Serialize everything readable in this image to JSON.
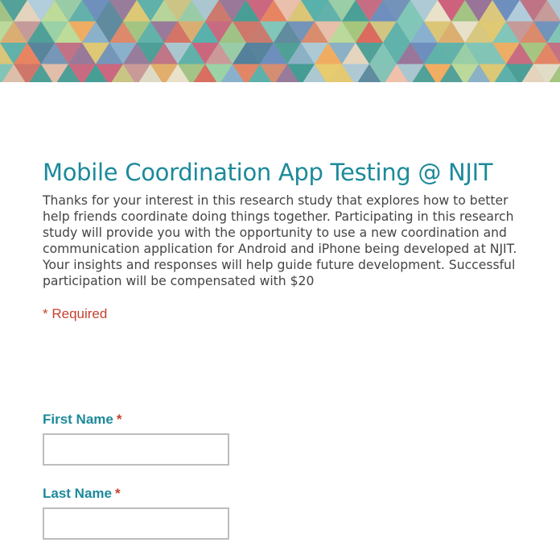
{
  "form": {
    "title": "Mobile Coordination App Testing @ NJIT",
    "description": "Thanks for your interest in this research study that explores how to better help friends coordinate doing things together. Participating in this research study will provide you with the opportunity to use a new coordination and communication application for Android and iPhone being developed at NJIT. Your insights and responses will help guide future development. Successful participation will be compensated with $20",
    "required_note": "* Required"
  },
  "questions": [
    {
      "label": "First Name",
      "required_marker": "*",
      "value": "",
      "placeholder": ""
    },
    {
      "label": "Last Name",
      "required_marker": "*",
      "value": "",
      "placeholder": ""
    }
  ],
  "theme": {
    "accent": "#1c8a9a",
    "required_color": "#c5432f",
    "text_color": "#444444",
    "input_border": "#bdbdbd"
  }
}
